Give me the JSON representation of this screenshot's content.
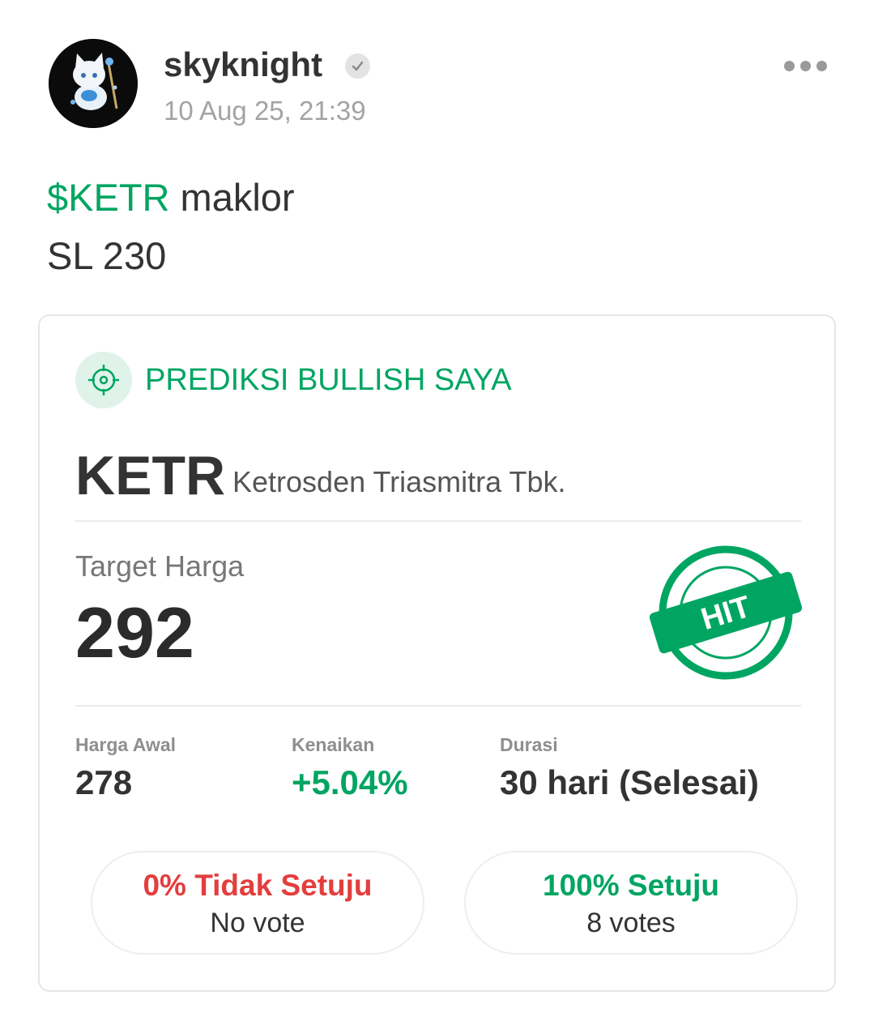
{
  "post": {
    "username": "skyknight",
    "verified_icon": "verified-check-icon",
    "timestamp": "10 Aug 25, 21:39",
    "menu_icon": "more-options-icon",
    "body": {
      "cashtag": "$KETR",
      "line1_rest": " maklor",
      "line2": "SL 230"
    }
  },
  "prediction": {
    "icon": "target-crosshair-icon",
    "label": "PREDIKSI BULLISH SAYA",
    "ticker": "KETR",
    "company": "Ketrosden Triasmitra Tbk.",
    "target_label": "Target Harga",
    "target_value": "292",
    "stamp_text": "HIT",
    "stats": [
      {
        "label": "Harga Awal",
        "value": "278"
      },
      {
        "label": "Kenaikan",
        "value": "+5.04%"
      },
      {
        "label": "Durasi",
        "value": "30 hari (Selesai)"
      }
    ],
    "votes": {
      "disagree": {
        "pct_label": "0% Tidak Setuju",
        "count_label": "No vote"
      },
      "agree": {
        "pct_label": "100% Setuju",
        "count_label": "8 votes"
      }
    }
  },
  "colors": {
    "brand_green": "#00a562",
    "disagree_red": "#e33e3e",
    "text_dark": "#333333",
    "text_muted": "#a3a3a3"
  }
}
